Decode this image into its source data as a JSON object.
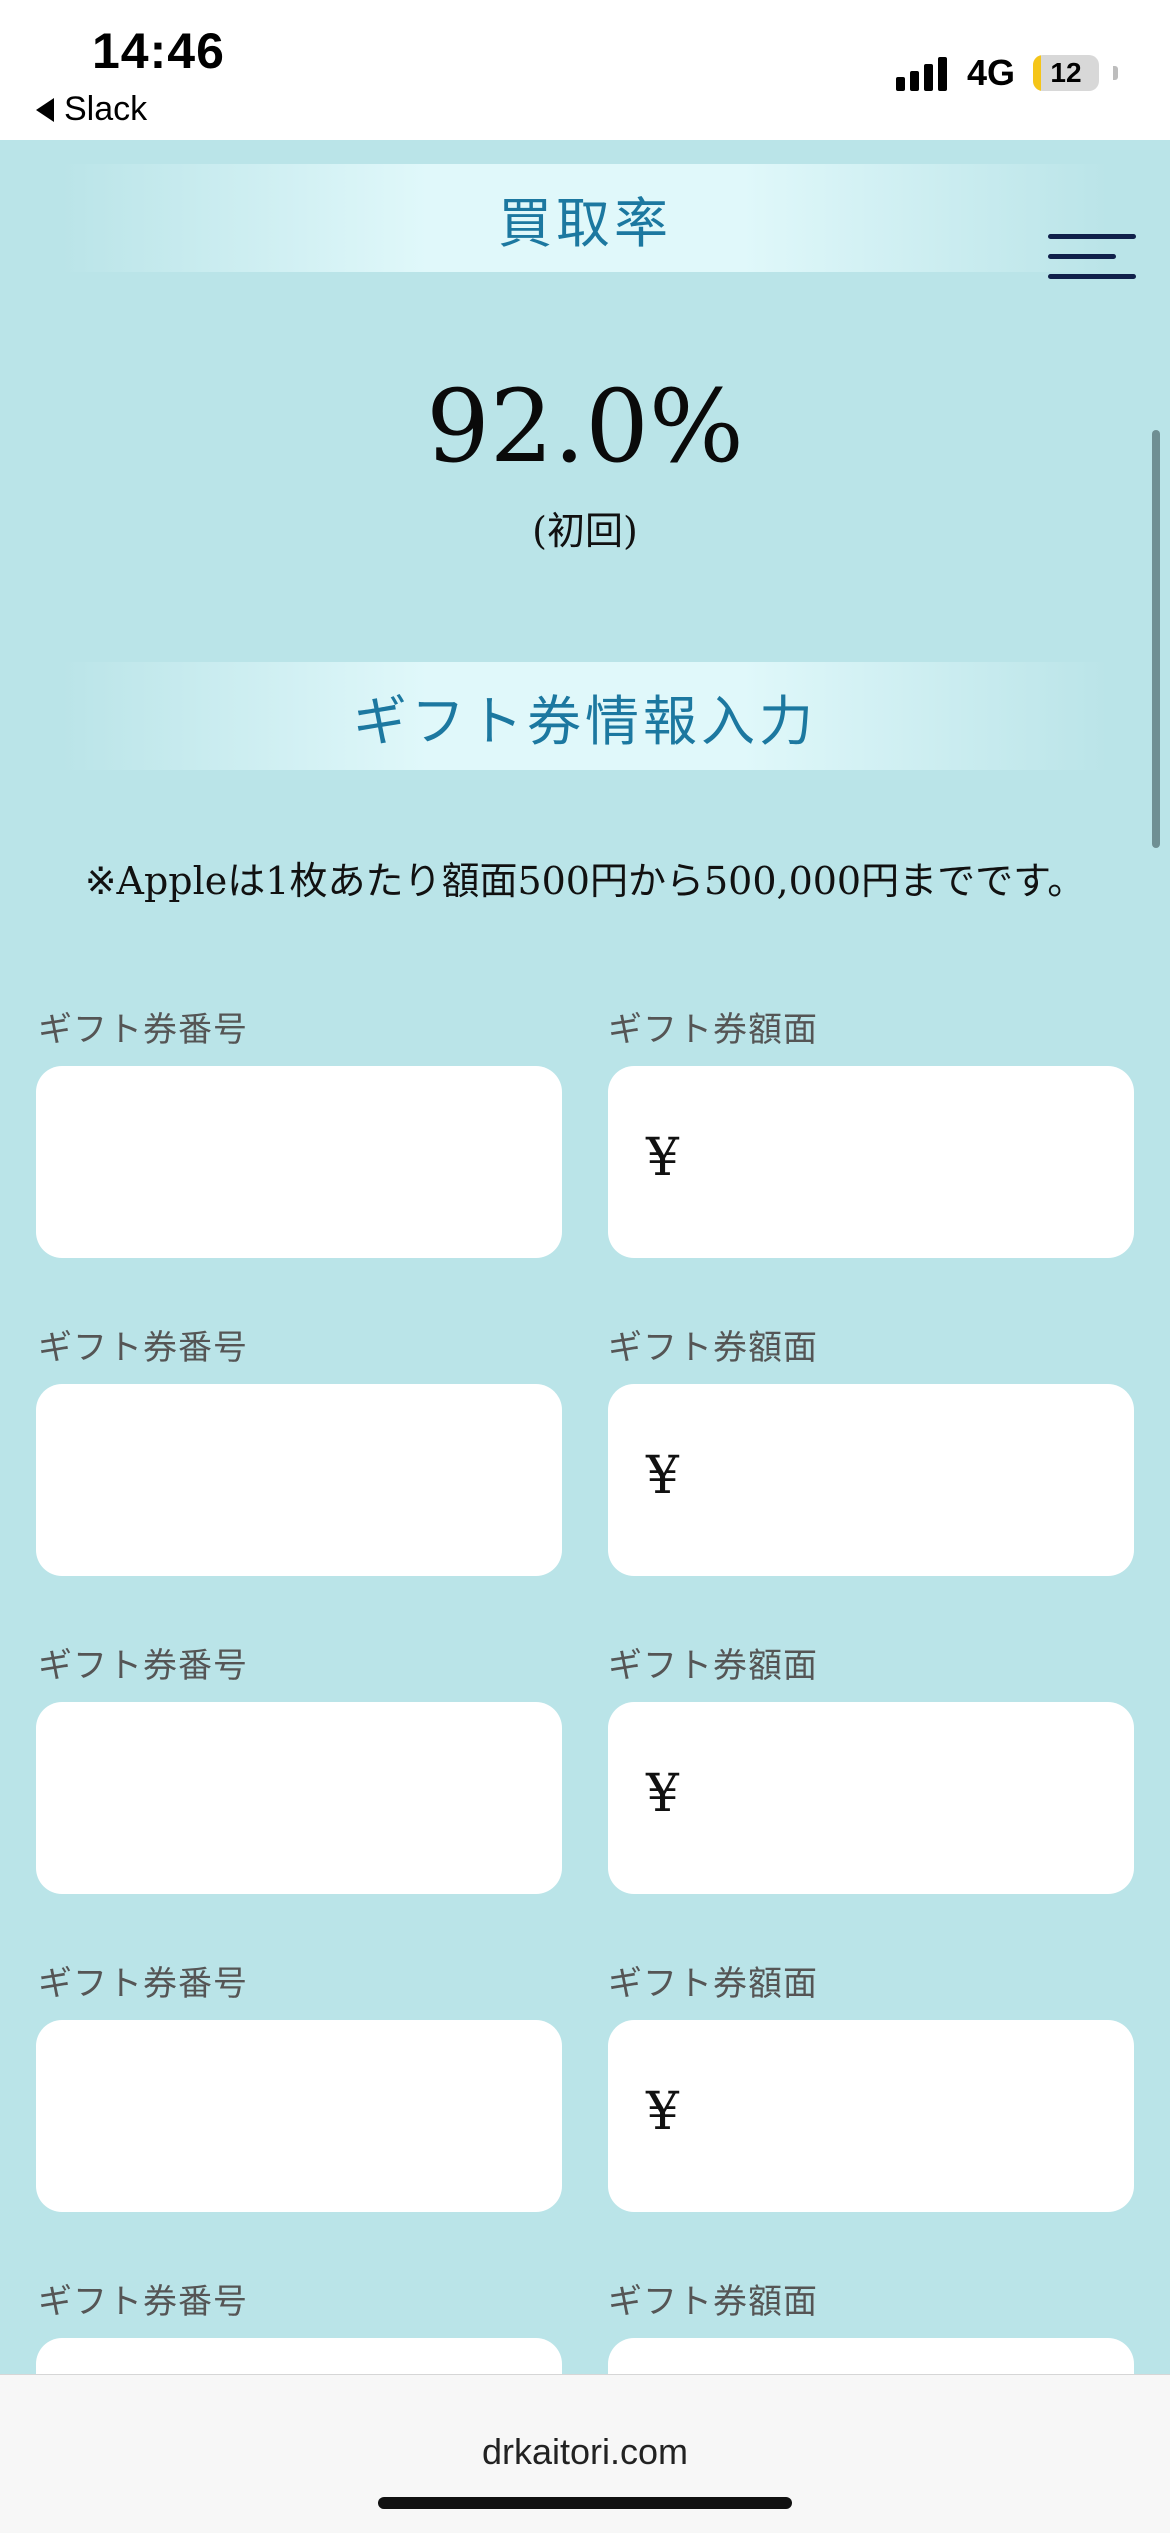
{
  "status_bar": {
    "time": "14:46",
    "back_app": "Slack",
    "network": "4G",
    "battery": "12",
    "battery_level_percent": 12
  },
  "page": {
    "rate_heading": "買取率",
    "rate_value": "92.0%",
    "rate_note": "(初回)",
    "gift_heading": "ギフト券情報入力",
    "notice": "※Appleは1枚あたり額面500円から500,000円までです。",
    "currency_symbol": "¥",
    "gift_rows": [
      {
        "number_label": "ギフト券番号",
        "number_value": "",
        "amount_label": "ギフト券額面",
        "amount_value": "¥"
      },
      {
        "number_label": "ギフト券番号",
        "number_value": "",
        "amount_label": "ギフト券額面",
        "amount_value": "¥"
      },
      {
        "number_label": "ギフト券番号",
        "number_value": "",
        "amount_label": "ギフト券額面",
        "amount_value": "¥"
      },
      {
        "number_label": "ギフト券番号",
        "number_value": "",
        "amount_label": "ギフト券額面",
        "amount_value": "¥"
      },
      {
        "number_label": "ギフト券番号",
        "number_value": "",
        "amount_label": "ギフト券額面",
        "amount_value": ""
      }
    ]
  },
  "browser": {
    "url": "drkaitori.com"
  },
  "colors": {
    "page_background": "#bae4e8",
    "heading_text": "#1c78a0",
    "menu_icon": "#10204a"
  },
  "icons": [
    "back-arrow-icon",
    "signal-icon",
    "battery-icon",
    "hamburger-menu-icon"
  ]
}
